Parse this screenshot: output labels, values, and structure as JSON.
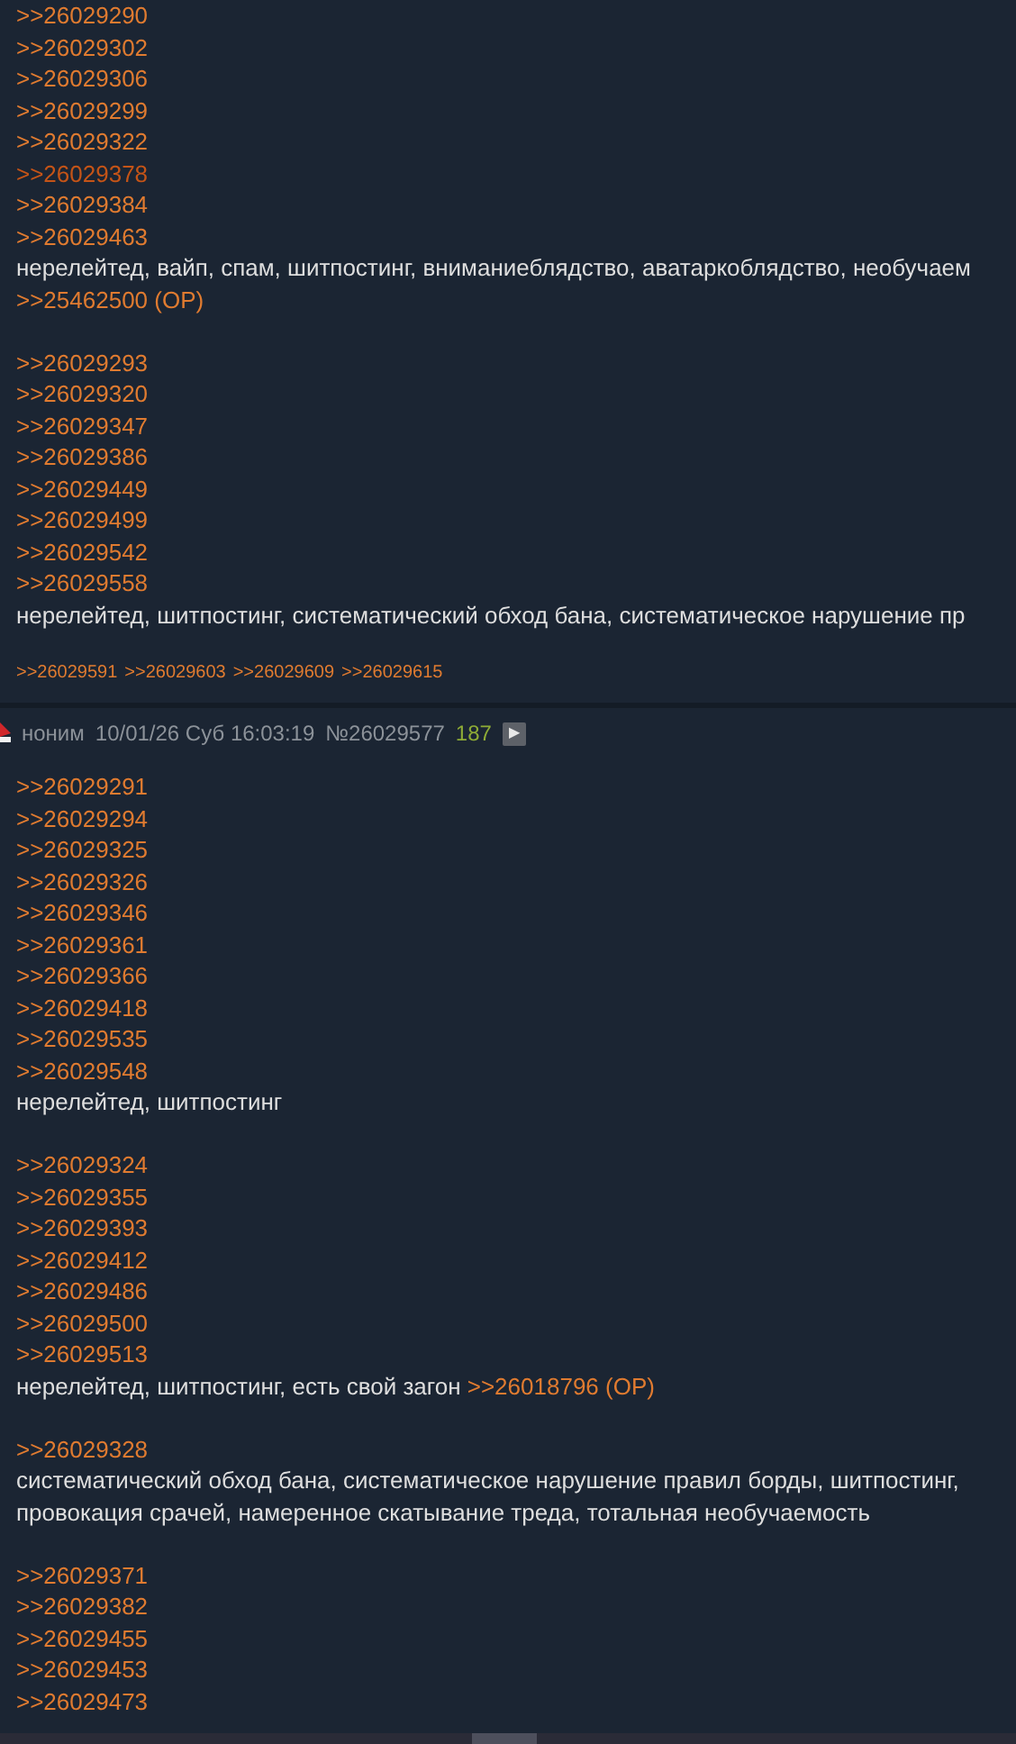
{
  "posts": [
    {
      "lines": [
        {
          "kind": "link",
          "text": ">>26029290",
          "visited": false
        },
        {
          "kind": "link",
          "text": ">>26029302",
          "visited": false
        },
        {
          "kind": "link",
          "text": ">>26029306",
          "visited": false
        },
        {
          "kind": "link",
          "text": ">>26029299",
          "visited": false
        },
        {
          "kind": "link",
          "text": ">>26029322",
          "visited": false
        },
        {
          "kind": "link",
          "text": ">>26029378",
          "visited": true
        },
        {
          "kind": "link",
          "text": ">>26029384",
          "visited": false
        },
        {
          "kind": "link",
          "text": ">>26029463",
          "visited": false
        },
        {
          "kind": "text",
          "text": "нерелейтед, вайп, спам, шитпостинг, вниманиеблядство, аватаркоблядство, необучаем"
        },
        {
          "kind": "link",
          "text": ">>25462500 (OP)",
          "visited": false
        },
        {
          "kind": "gap"
        },
        {
          "kind": "link",
          "text": ">>26029293",
          "visited": false
        },
        {
          "kind": "link",
          "text": ">>26029320",
          "visited": false
        },
        {
          "kind": "link",
          "text": ">>26029347",
          "visited": false
        },
        {
          "kind": "link",
          "text": ">>26029386",
          "visited": false
        },
        {
          "kind": "link",
          "text": ">>26029449",
          "visited": false
        },
        {
          "kind": "link",
          "text": ">>26029499",
          "visited": false
        },
        {
          "kind": "link",
          "text": ">>26029542",
          "visited": false
        },
        {
          "kind": "link",
          "text": ">>26029558",
          "visited": false
        },
        {
          "kind": "text",
          "text": "нерелейтед, шитпостинг, систематический обход бана, систематическое нарушение пр"
        }
      ],
      "replies": [
        ">>26029591",
        ">>26029603",
        ">>26029609",
        ">>26029615"
      ]
    },
    {
      "header": {
        "name": "ноним",
        "date": "10/01/26 Суб 16:03:19",
        "number": "№26029577",
        "count": "187",
        "play": "▶"
      },
      "lines": [
        {
          "kind": "link",
          "text": ">>26029291",
          "visited": false
        },
        {
          "kind": "link",
          "text": ">>26029294",
          "visited": false
        },
        {
          "kind": "link",
          "text": ">>26029325",
          "visited": false
        },
        {
          "kind": "link",
          "text": ">>26029326",
          "visited": false
        },
        {
          "kind": "link",
          "text": ">>26029346",
          "visited": false
        },
        {
          "kind": "link",
          "text": ">>26029361",
          "visited": false
        },
        {
          "kind": "link",
          "text": ">>26029366",
          "visited": false
        },
        {
          "kind": "link",
          "text": ">>26029418",
          "visited": false
        },
        {
          "kind": "link",
          "text": ">>26029535",
          "visited": false
        },
        {
          "kind": "link",
          "text": ">>26029548",
          "visited": false
        },
        {
          "kind": "text",
          "text": "нерелейтед, шитпостинг"
        },
        {
          "kind": "gap"
        },
        {
          "kind": "link",
          "text": ">>26029324",
          "visited": false
        },
        {
          "kind": "link",
          "text": ">>26029355",
          "visited": false
        },
        {
          "kind": "link",
          "text": ">>26029393",
          "visited": false
        },
        {
          "kind": "link",
          "text": ">>26029412",
          "visited": false
        },
        {
          "kind": "link",
          "text": ">>26029486",
          "visited": false
        },
        {
          "kind": "link",
          "text": ">>26029500",
          "visited": false
        },
        {
          "kind": "link",
          "text": ">>26029513",
          "visited": false
        },
        {
          "kind": "text",
          "text": "нерелейтед, шитпостинг, есть свой загон ",
          "link": ">>26018796 (OP)"
        },
        {
          "kind": "gap"
        },
        {
          "kind": "link",
          "text": ">>26029328",
          "visited": false
        },
        {
          "kind": "text",
          "text": "систематический обход бана, систематическое нарушение правил борды, шитпостинг, "
        },
        {
          "kind": "text",
          "text": "провокация срачей, намеренное скатывание треда, тотальная необучаемость"
        },
        {
          "kind": "gap"
        },
        {
          "kind": "link",
          "text": ">>26029371",
          "visited": false
        },
        {
          "kind": "link",
          "text": ">>26029382",
          "visited": false
        },
        {
          "kind": "link",
          "text": ">>26029455",
          "visited": false
        },
        {
          "kind": "link",
          "text": ">>26029453",
          "visited": false
        },
        {
          "kind": "link",
          "text": ">>26029473",
          "visited": false
        }
      ]
    }
  ]
}
